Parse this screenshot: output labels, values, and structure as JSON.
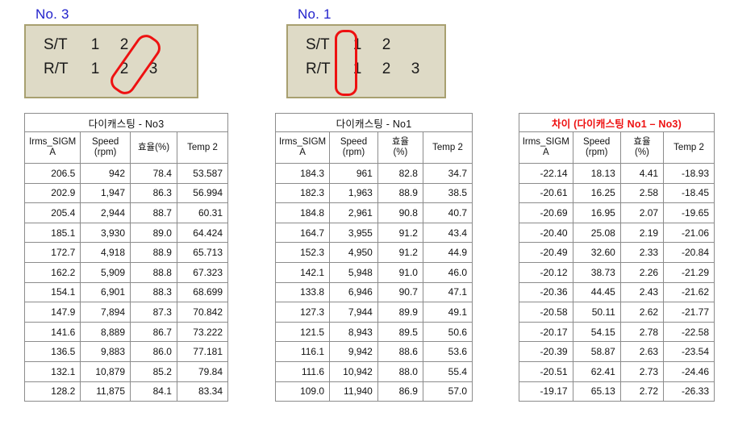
{
  "conditions": [
    {
      "id": "no3",
      "label": "No. 3",
      "rows": [
        {
          "name": "S/T",
          "cells": [
            "1",
            "2",
            ""
          ]
        },
        {
          "name": "R/T",
          "cells": [
            "1",
            "2",
            "3"
          ]
        }
      ],
      "highlight": "diagonal"
    },
    {
      "id": "no1",
      "label": "No. 1",
      "rows": [
        {
          "name": "S/T",
          "cells": [
            "1",
            "2",
            ""
          ]
        },
        {
          "name": "R/T",
          "cells": [
            "1",
            "2",
            "3"
          ]
        }
      ],
      "highlight": "vertical"
    }
  ],
  "colors": {
    "label_blue": "#2222cc",
    "highlight_red": "#ee1111",
    "box_fill": "#dedac6",
    "box_border": "#a8a070",
    "grid": "#8c8c8c"
  },
  "tables": [
    {
      "id": "no3",
      "title": "다이캐스팅 - No3",
      "title_red": false,
      "columns": [
        {
          "line1": "Irms_SIGM",
          "line2": "A",
          "inline": false
        },
        {
          "line1": "Speed",
          "line2": "(rpm)",
          "inline": false
        },
        {
          "line1": "효율",
          "line2": "(%)",
          "inline": true
        },
        {
          "line1": "Temp 2",
          "line2": "",
          "inline": false
        }
      ],
      "red_columns": [],
      "rows": [
        [
          "206.5",
          "942",
          "78.4",
          "53.587"
        ],
        [
          "202.9",
          "1,947",
          "86.3",
          "56.994"
        ],
        [
          "205.4",
          "2,944",
          "88.7",
          "60.31"
        ],
        [
          "185.1",
          "3,930",
          "89.0",
          "64.424"
        ],
        [
          "172.7",
          "4,918",
          "88.9",
          "65.713"
        ],
        [
          "162.2",
          "5,909",
          "88.8",
          "67.323"
        ],
        [
          "154.1",
          "6,901",
          "88.3",
          "68.699"
        ],
        [
          "147.9",
          "7,894",
          "87.3",
          "70.842"
        ],
        [
          "141.6",
          "8,889",
          "86.7",
          "73.222"
        ],
        [
          "136.5",
          "9,883",
          "86.0",
          "77.181"
        ],
        [
          "132.1",
          "10,879",
          "85.2",
          "79.84"
        ],
        [
          "128.2",
          "11,875",
          "84.1",
          "83.34"
        ]
      ]
    },
    {
      "id": "no1",
      "title": "다이캐스팅 - No1",
      "title_red": false,
      "columns": [
        {
          "line1": "Irms_SIGM",
          "line2": "A",
          "inline": false
        },
        {
          "line1": "Speed",
          "line2": "(rpm)",
          "inline": false
        },
        {
          "line1": "효율",
          "line2": "(%)",
          "inline": false
        },
        {
          "line1": "Temp 2",
          "line2": "",
          "inline": false
        }
      ],
      "red_columns": [],
      "rows": [
        [
          "184.3",
          "961",
          "82.8",
          "34.7"
        ],
        [
          "182.3",
          "1,963",
          "88.9",
          "38.5"
        ],
        [
          "184.8",
          "2,961",
          "90.8",
          "40.7"
        ],
        [
          "164.7",
          "3,955",
          "91.2",
          "43.4"
        ],
        [
          "152.3",
          "4,950",
          "91.2",
          "44.9"
        ],
        [
          "142.1",
          "5,948",
          "91.0",
          "46.0"
        ],
        [
          "133.8",
          "6,946",
          "90.7",
          "47.1"
        ],
        [
          "127.3",
          "7,944",
          "89.9",
          "49.1"
        ],
        [
          "121.5",
          "8,943",
          "89.5",
          "50.6"
        ],
        [
          "116.1",
          "9,942",
          "88.6",
          "53.6"
        ],
        [
          "111.6",
          "10,942",
          "88.0",
          "55.4"
        ],
        [
          "109.0",
          "11,940",
          "86.9",
          "57.0"
        ]
      ]
    },
    {
      "id": "diff",
      "title": "차이 (다이캐스팅 No1 – No3)",
      "title_red": true,
      "columns": [
        {
          "line1": "Irms_SIGM",
          "line2": "A",
          "inline": false
        },
        {
          "line1": "Speed",
          "line2": "(rpm)",
          "inline": false
        },
        {
          "line1": "효율",
          "line2": "(%)",
          "inline": false
        },
        {
          "line1": "Temp 2",
          "line2": "",
          "inline": false
        }
      ],
      "red_columns": [
        0,
        2
      ],
      "rows": [
        [
          "-22.14",
          "18.13",
          "4.41",
          "-18.93"
        ],
        [
          "-20.61",
          "16.25",
          "2.58",
          "-18.45"
        ],
        [
          "-20.69",
          "16.95",
          "2.07",
          "-19.65"
        ],
        [
          "-20.40",
          "25.08",
          "2.19",
          "-21.06"
        ],
        [
          "-20.49",
          "32.60",
          "2.33",
          "-20.84"
        ],
        [
          "-20.12",
          "38.73",
          "2.26",
          "-21.29"
        ],
        [
          "-20.36",
          "44.45",
          "2.43",
          "-21.62"
        ],
        [
          "-20.58",
          "50.11",
          "2.62",
          "-21.77"
        ],
        [
          "-20.17",
          "54.15",
          "2.78",
          "-22.58"
        ],
        [
          "-20.39",
          "58.87",
          "2.63",
          "-23.54"
        ],
        [
          "-20.51",
          "62.41",
          "2.73",
          "-24.46"
        ],
        [
          "-19.17",
          "65.13",
          "2.72",
          "-26.33"
        ]
      ]
    }
  ]
}
